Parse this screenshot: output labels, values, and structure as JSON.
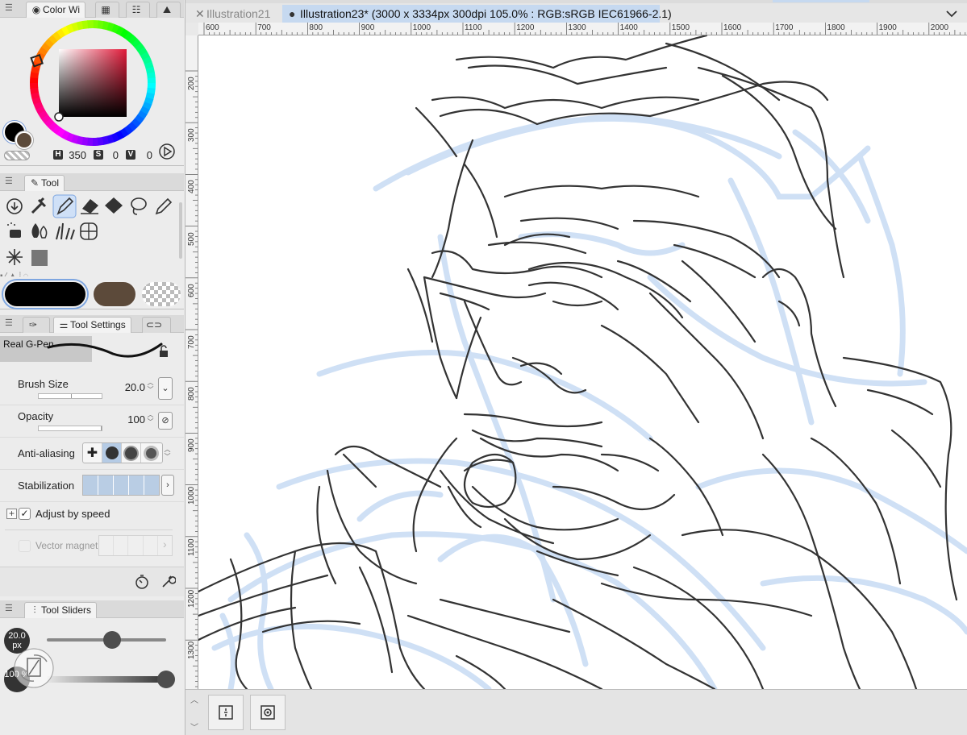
{
  "color_panel": {
    "tab_label": "Color Wi",
    "h_label": "H",
    "h_value": "350",
    "s_label": "S",
    "s_value": "0",
    "v_label": "V",
    "v_value": "0",
    "main_color": "#000000",
    "sub_color": "#5c4a3a"
  },
  "tool_panel": {
    "tab_label": "Tool",
    "tools": [
      "download-tool",
      "dropper-tool",
      "pen-tool",
      "eraser-tool",
      "fill-tool",
      "lasso-tool",
      "pencil-tool",
      "spray-tool",
      "blend-tool",
      "grass-tool",
      "mesh-tool",
      "sparkle-tool",
      "gradient-tool"
    ],
    "selected_tool": "pen-tool",
    "swatches": [
      "#000000",
      "#5c4a3a",
      "transparent"
    ]
  },
  "tool_settings": {
    "tab_label": "Tool Settings",
    "brush_name": "Real G-Pen",
    "brush_size_label": "Brush Size",
    "brush_size_value": "20.0",
    "opacity_label": "Opacity",
    "opacity_value": "100",
    "anti_aliasing_label": "Anti-aliasing",
    "stabilization_label": "Stabilization",
    "adjust_by_speed_label": "Adjust by speed",
    "adjust_by_speed_checked": true,
    "vector_magnet_label": "Vector magnet"
  },
  "tool_sliders": {
    "tab_label": "Tool Sliders",
    "size_badge": "20.0 px",
    "opacity_badge": "100 %",
    "size_level": 0.55,
    "opacity_level": 1.0
  },
  "document_tabs": {
    "inactive_tab": "Illustration21",
    "active_tab": "Illustration23* (3000 x 3334px 300dpi 105.0% : RGB:sRGB IEC61966-2.1)",
    "accent": "#c6d9f0"
  },
  "rulers": {
    "horizontal": [
      "600",
      "700",
      "800",
      "900",
      "1000",
      "1100",
      "1200",
      "1300",
      "1400",
      "1500",
      "1600",
      "1700",
      "1800",
      "1900",
      "2000"
    ],
    "vertical": [
      "200",
      "300",
      "400",
      "500",
      "600",
      "700",
      "800",
      "900",
      "1000",
      "1100",
      "1200",
      "1300"
    ]
  },
  "colors": {
    "sketch_line": "#333333",
    "underdrawing": "#cfe0f5",
    "selection": "#cfe0f7"
  }
}
